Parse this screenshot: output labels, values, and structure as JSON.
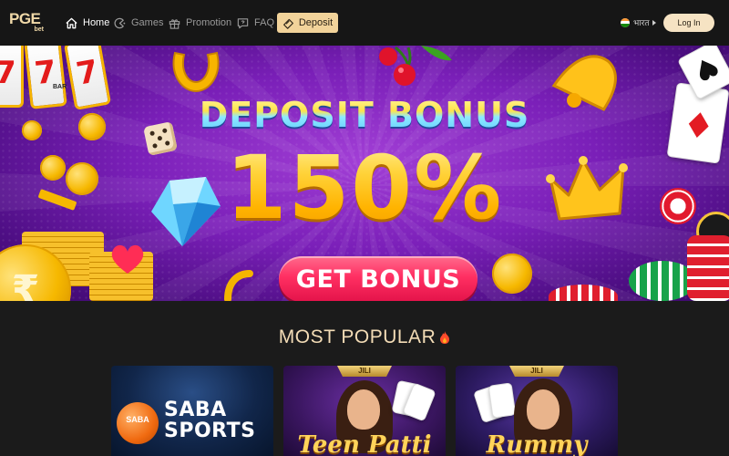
{
  "nav": {
    "logo": {
      "main": "PGE",
      "sub": "bet"
    },
    "items": [
      {
        "label": "Home",
        "icon": "home-icon",
        "active": true
      },
      {
        "label": "Games",
        "icon": "games-icon",
        "active": false
      },
      {
        "label": "Promotion",
        "icon": "gift-icon",
        "active": false
      },
      {
        "label": "FAQ",
        "icon": "faq-icon",
        "active": false
      }
    ],
    "deposit_label": "Deposit",
    "language": "भारत",
    "login_label": "Log In"
  },
  "banner": {
    "title": "DEPOSIT BONUS",
    "percent": "150%",
    "button_label": "GET BONUS",
    "slot_symbols": [
      "7",
      "7",
      "7"
    ],
    "slot_bar_label": "BAR",
    "coin_symbol": "₹"
  },
  "section": {
    "title": "MOST POPULAR"
  },
  "games": [
    {
      "name": "SABA SPORTS",
      "line1": "SABA",
      "line2": "SPORTS",
      "badge": "SABA",
      "provider": ""
    },
    {
      "name": "Teen Patti",
      "title": "Teen Patti",
      "provider": "JILI"
    },
    {
      "name": "Rummy",
      "title": "Rummy",
      "provider": "JILI"
    }
  ],
  "colors": {
    "nav_bg": "#161616",
    "page_bg": "#1b1b1b",
    "accent": "#f2d39a",
    "banner_purple": "#7a1fb8",
    "bonus_gold": "#ffd33a",
    "button_pink": "#ff2f62",
    "section_title": "#f3dcb6"
  }
}
